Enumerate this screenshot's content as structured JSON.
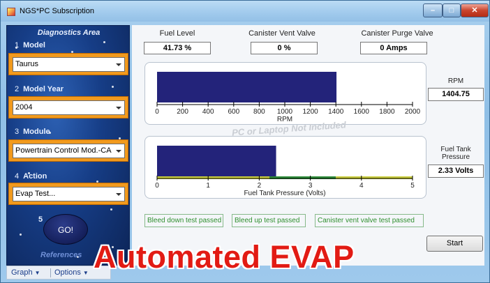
{
  "window": {
    "title": "NGS*PC Subscription",
    "min_label": "–",
    "max_label": "□",
    "close_label": "✕"
  },
  "sidebar": {
    "title": "Diagnostics Area",
    "steps": [
      {
        "num": "1",
        "label": "Model",
        "value": "Taurus"
      },
      {
        "num": "2",
        "label": "Model Year",
        "value": "2004"
      },
      {
        "num": "3",
        "label": "Module",
        "value": "Powertrain Control Mod.-CA"
      },
      {
        "num": "4",
        "label": "Action",
        "value": "Evap Test..."
      }
    ],
    "step5_num": "5",
    "go_label": "GO!",
    "references_label": "References"
  },
  "bottombar": {
    "graph_label": "Graph",
    "options_label": "Options"
  },
  "gauges": {
    "fuel_level": {
      "label": "Fuel Level",
      "value": "41.73 %"
    },
    "canister_vent": {
      "label": "Canister Vent Valve",
      "value": "0 %"
    },
    "canister_purge": {
      "label": "Canister Purge Valve",
      "value": "0 Amps"
    }
  },
  "rpm_chart": {
    "ticks": [
      "0",
      "200",
      "400",
      "600",
      "800",
      "1000",
      "1200",
      "1400",
      "1600",
      "1800",
      "2000"
    ],
    "axis_label": "RPM",
    "readout_label": "RPM",
    "readout_value": "1404.75"
  },
  "fuel_chart": {
    "ticks": [
      "0",
      "1",
      "2",
      "3",
      "4",
      "5"
    ],
    "axis_label": "Fuel Tank Pressure (Volts)",
    "readout_label_line1": "Fuel Tank",
    "readout_label_line2": "Pressure",
    "readout_value": "2.33 Volts"
  },
  "chart_data": [
    {
      "type": "bar",
      "orientation": "horizontal",
      "series": [
        {
          "values": [
            1404.75
          ]
        }
      ],
      "xlabel": "RPM",
      "xlim": [
        0,
        2000
      ],
      "bar_color": "#23237a"
    },
    {
      "type": "bar",
      "orientation": "horizontal",
      "series": [
        {
          "values": [
            2.33
          ]
        }
      ],
      "xlabel": "Fuel Tank Pressure (Volts)",
      "xlim": [
        0,
        5
      ],
      "bar_color": "#23237a",
      "bands": [
        {
          "from": 0,
          "to": 2.2,
          "color": "#c8cc3c"
        },
        {
          "from": 2.2,
          "to": 3.5,
          "color": "#2e8b3a"
        },
        {
          "from": 3.5,
          "to": 5,
          "color": "#c8cc3c"
        }
      ]
    }
  ],
  "watermark": "PC or Laptop Not Included",
  "status": {
    "bleed_down": "Bleed down test passed",
    "bleed_up": "Bleed up test passed",
    "vent_valve": "Canister vent valve test passed"
  },
  "start_label": "Start",
  "banner": "Automated EVAP",
  "colors": {
    "accent_orange": "#f19a1e",
    "sidebar_blue": "#163d86",
    "pass_green": "#2f8f2f",
    "banner_red": "#e21b14"
  }
}
